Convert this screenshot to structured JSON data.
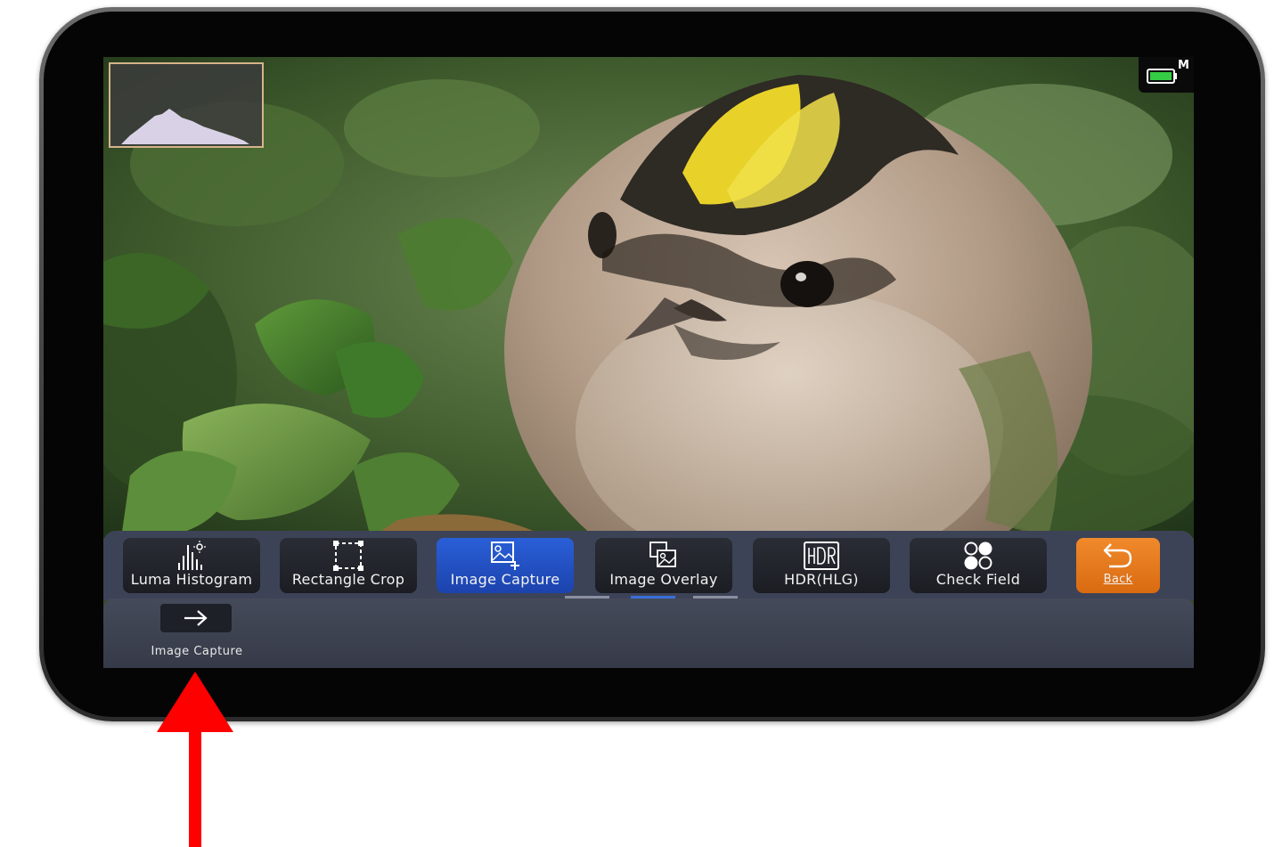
{
  "toolbar": {
    "buttons": [
      {
        "label": "Luma Histogram",
        "icon": "luma-histogram-icon",
        "state": "normal"
      },
      {
        "label": "Rectangle Crop",
        "icon": "rectangle-crop-icon",
        "state": "normal"
      },
      {
        "label": "Image Capture",
        "icon": "image-capture-icon",
        "state": "selected"
      },
      {
        "label": "Image Overlay",
        "icon": "image-overlay-icon",
        "state": "normal"
      },
      {
        "label": "HDR(HLG)",
        "icon": "hdr-icon",
        "state": "normal"
      },
      {
        "label": "Check Field",
        "icon": "check-field-icon",
        "state": "normal"
      }
    ],
    "back_label": "Back"
  },
  "subpanel": {
    "action_icon": "arrow-right-icon",
    "label": "Image Capture"
  },
  "status": {
    "battery_icon": "battery-icon",
    "mode_letter": "M"
  },
  "colors": {
    "active_button": "#2455c8",
    "back_button": "#e8791e",
    "toolbar_bg": "#3d4356",
    "annotation_arrow": "#ff0000",
    "histogram_border": "#d6b48a"
  }
}
